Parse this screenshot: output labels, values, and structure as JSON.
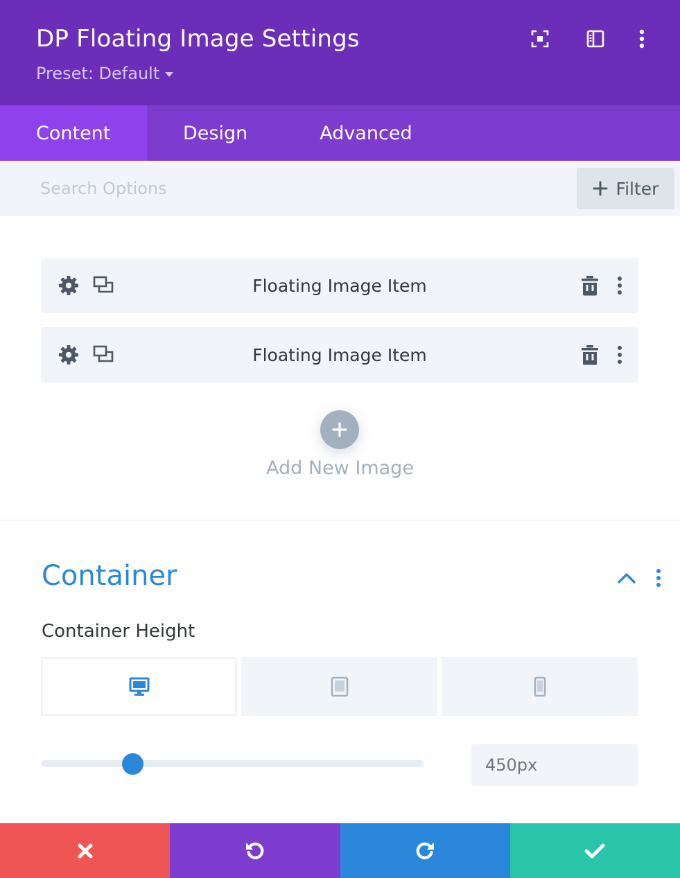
{
  "header": {
    "title": "DP Floating Image Settings",
    "preset": "Preset: Default",
    "bg_color": "#6c2eb9",
    "icons": [
      "focus-mode-icon",
      "split-view-icon",
      "more-options-icon"
    ]
  },
  "tabs": [
    {
      "label": "Content",
      "active": true
    },
    {
      "label": "Design",
      "active": false
    },
    {
      "label": "Advanced",
      "active": false
    }
  ],
  "search": {
    "placeholder": "Search Options",
    "value": "",
    "filter_label": "Filter"
  },
  "items": [
    {
      "label": "Floating Image Item"
    },
    {
      "label": "Floating Image Item"
    }
  ],
  "add_new": {
    "label": "Add New Image"
  },
  "container": {
    "title": "Container",
    "accent": "#2b87da",
    "field_label": "Container Height",
    "devices": [
      {
        "name": "desktop",
        "active": true
      },
      {
        "name": "tablet",
        "active": false
      },
      {
        "name": "phone",
        "active": false
      }
    ],
    "slider_fraction": 0.24,
    "value_placeholder": "450px"
  },
  "footer": {
    "buttons": [
      {
        "name": "cancel",
        "color": "#ef5555"
      },
      {
        "name": "undo",
        "color": "#7e3bd0"
      },
      {
        "name": "redo",
        "color": "#2b87da"
      },
      {
        "name": "save",
        "color": "#29c4a9"
      }
    ]
  }
}
